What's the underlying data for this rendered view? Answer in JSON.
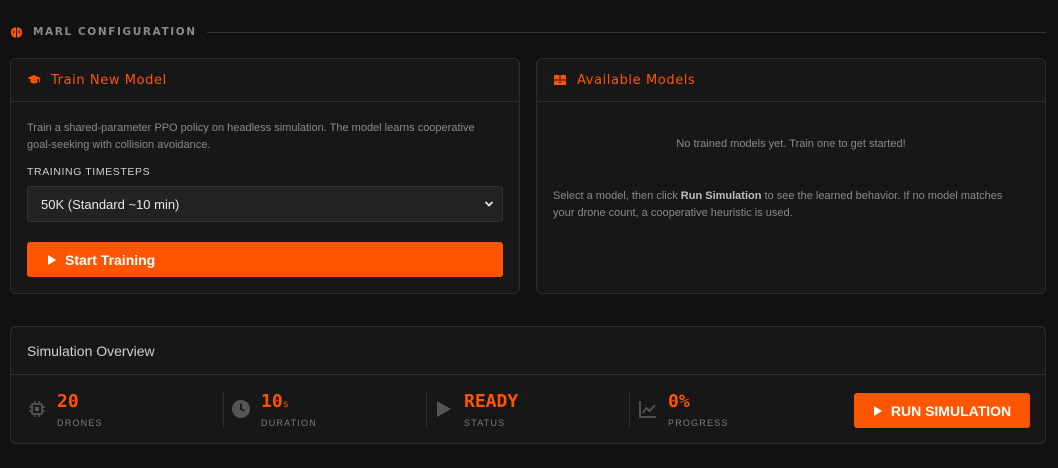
{
  "section": {
    "title": "MARL CONFIGURATION",
    "icon": "brain-icon"
  },
  "train_card": {
    "title": "Train New Model",
    "icon": "graduation-cap-icon",
    "description": "Train a shared-parameter PPO policy on headless simulation. The model learns cooperative goal-seeking with collision avoidance.",
    "timesteps_label": "TRAINING TIMESTEPS",
    "timesteps_selected": "50K (Standard ~10 min)",
    "start_button": "Start Training"
  },
  "models_card": {
    "title": "Available Models",
    "icon": "boxes-icon",
    "empty_message": "No trained models yet. Train one to get started!",
    "hint_prefix": "Select a model, then click ",
    "hint_emphasis": "Run Simulation",
    "hint_suffix": " to see the learned behavior. If no model matches your drone count, a cooperative heuristic is used."
  },
  "overview": {
    "title": "Simulation Overview",
    "stats": [
      {
        "value": "20",
        "unit": "",
        "label": "DRONES",
        "icon": "chip-icon"
      },
      {
        "value": "10",
        "unit": "s",
        "label": "DURATION",
        "icon": "clock-icon"
      },
      {
        "value": "READY",
        "unit": "",
        "label": "STATUS",
        "icon": "play-icon"
      },
      {
        "value": "0%",
        "unit": "",
        "label": "PROGRESS",
        "icon": "chart-line-icon"
      }
    ],
    "run_button": "RUN SIMULATION"
  },
  "colors": {
    "accent": "#ff5500",
    "background": "#111111",
    "card": "#171717",
    "border": "#2d2d2d"
  }
}
